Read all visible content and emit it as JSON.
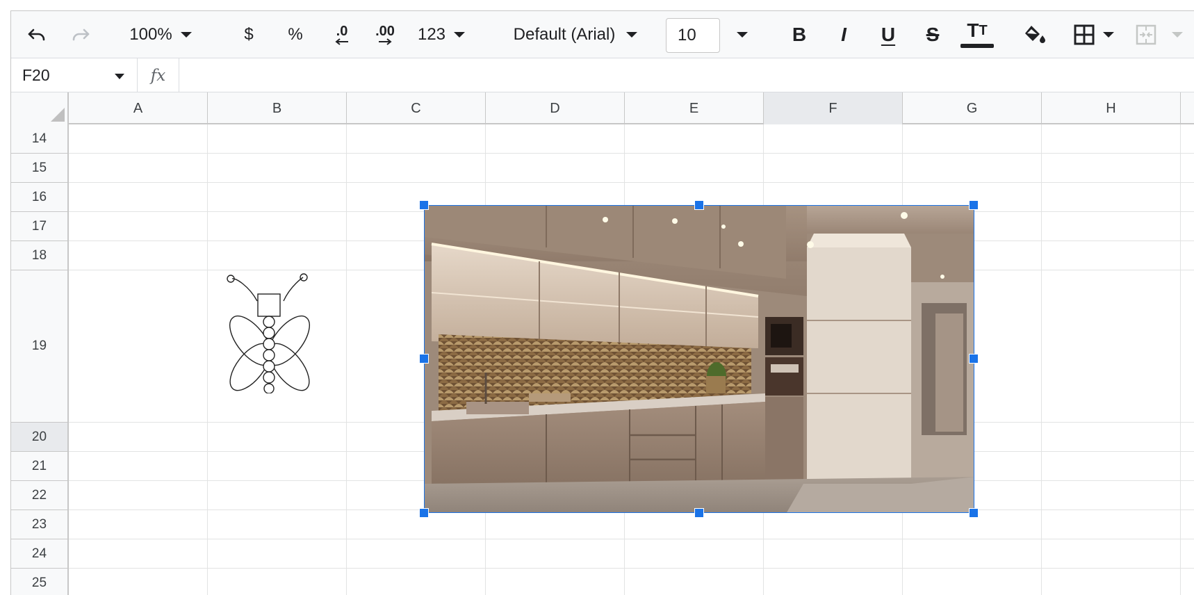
{
  "toolbar": {
    "zoom": "100%",
    "currency": "$",
    "percent": "%",
    "decrease_decimal": ".0",
    "increase_decimal": ".00",
    "number_format": "123",
    "font_family": "Default (Arial)",
    "font_size": "10",
    "bold": "B",
    "italic": "I",
    "underline": "U",
    "strikethrough": "S",
    "text_color": "T",
    "text_color_sub": "T"
  },
  "formula_bar": {
    "cell_ref": "F20",
    "fx": "fx",
    "value": ""
  },
  "columns": [
    "A",
    "B",
    "C",
    "D",
    "E",
    "F",
    "G",
    "H"
  ],
  "rows": [
    "14",
    "15",
    "16",
    "17",
    "18",
    "19",
    "20",
    "21",
    "22",
    "23",
    "24",
    "25"
  ],
  "selected_column": "F",
  "selected_row": "20",
  "colors": {
    "selection": "#1a73e8",
    "header_bg": "#f8f9fa",
    "grid_line": "#e2e3e3"
  },
  "icons": {
    "undo": "undo-icon",
    "redo": "redo-icon",
    "paint_format": "fill-color-icon",
    "borders": "borders-icon",
    "merge": "merge-cells-icon"
  }
}
